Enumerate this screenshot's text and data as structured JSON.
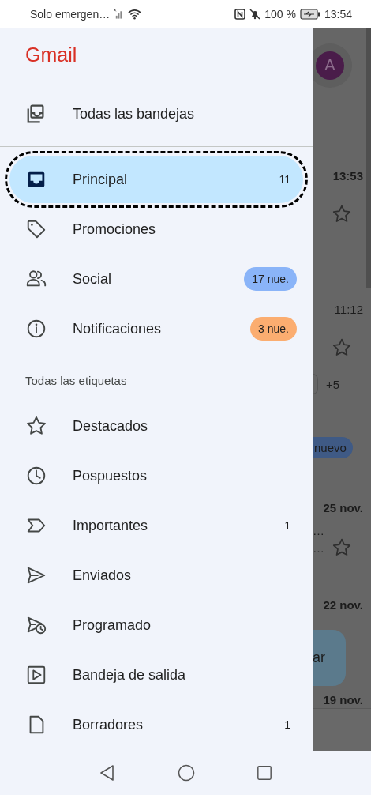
{
  "status_bar": {
    "carrier": "Solo emergen…",
    "battery": "100 %",
    "time": "13:54"
  },
  "drawer": {
    "title": "Gmail",
    "top_item": {
      "label": "Todas las bandejas",
      "selected": false
    },
    "categories": [
      {
        "label": "Principal",
        "count": "11",
        "selected": true
      },
      {
        "label": "Promociones",
        "selected": false
      },
      {
        "label": "Social",
        "badge": "17 nue.",
        "color": "#8ab4f8",
        "selected": false
      },
      {
        "label": "Notificaciones",
        "badge": "3 nue.",
        "color": "#fbad70",
        "selected": false
      }
    ],
    "section_title": "Todas las etiquetas",
    "labels": [
      {
        "label": "Destacados",
        "selected": false
      },
      {
        "label": "Pospuestos",
        "selected": false
      },
      {
        "label": "Importantes",
        "count": "1",
        "selected": false
      },
      {
        "label": "Enviados",
        "selected": false
      },
      {
        "label": "Programado",
        "selected": false
      },
      {
        "label": "Bandeja de salida",
        "selected": false
      },
      {
        "label": "Borradores",
        "count": "1",
        "selected": false
      }
    ]
  },
  "background": [
    {
      "kind": "avatar",
      "text": "A"
    },
    {
      "kind": "time",
      "text": "13:53",
      "bold": true
    },
    {
      "kind": "star"
    },
    {
      "kind": "time",
      "text": "11:12",
      "bold": false
    },
    {
      "kind": "star"
    },
    {
      "kind": "more",
      "text": "+5"
    },
    {
      "kind": "pill",
      "text": "nuevo"
    },
    {
      "kind": "time",
      "text": "25 nov.",
      "bold": true
    },
    {
      "kind": "snippet",
      "text": "…"
    },
    {
      "kind": "snippet-star",
      "text": "…"
    },
    {
      "kind": "time",
      "text": "22 nov.",
      "bold": true
    },
    {
      "kind": "compose",
      "text": "ar"
    },
    {
      "kind": "time",
      "text": "19 nov.",
      "bold": true
    }
  ]
}
